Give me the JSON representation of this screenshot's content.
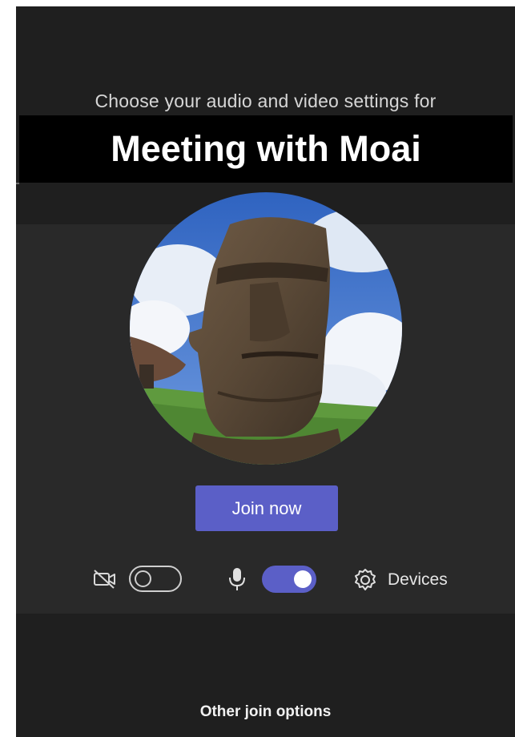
{
  "prompt": {
    "subtitle": "Choose your audio and video settings for",
    "meeting_title": "Meeting with Moai"
  },
  "preview": {
    "avatar_subject": "moai-statue"
  },
  "actions": {
    "join_label": "Join now",
    "other_options_label": "Other join options"
  },
  "controls": {
    "camera": {
      "icon": "camera-off-icon",
      "toggle_state": "off"
    },
    "microphone": {
      "icon": "microphone-icon",
      "toggle_state": "on"
    },
    "devices": {
      "icon": "gear-icon",
      "label": "Devices"
    }
  },
  "colors": {
    "background": "#1f1f1f",
    "panel": "#292929",
    "accent": "#5b5fc7",
    "banner": "#000000"
  }
}
